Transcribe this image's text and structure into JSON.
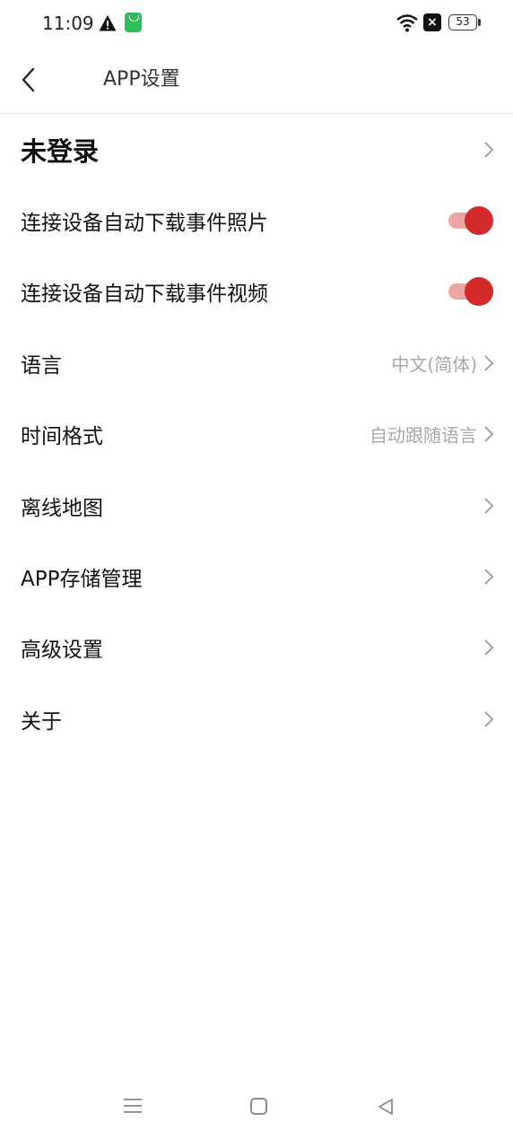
{
  "status_bar": {
    "time": "11:09",
    "battery": "53"
  },
  "header": {
    "title": "APP设置"
  },
  "settings": {
    "login": {
      "label": "未登录"
    },
    "auto_download_photos": {
      "label": "连接设备自动下载事件照片",
      "enabled": true
    },
    "auto_download_videos": {
      "label": "连接设备自动下载事件视频",
      "enabled": true
    },
    "language": {
      "label": "语言",
      "value": "中文(简体)"
    },
    "time_format": {
      "label": "时间格式",
      "value": "自动跟随语言"
    },
    "offline_map": {
      "label": "离线地图"
    },
    "storage": {
      "label": "APP存储管理"
    },
    "advanced": {
      "label": "高级设置"
    },
    "about": {
      "label": "关于"
    }
  },
  "colors": {
    "accent": "#d42a2a",
    "toggle_track": "#eda5a4",
    "secondary_text": "#a8a8a8"
  }
}
